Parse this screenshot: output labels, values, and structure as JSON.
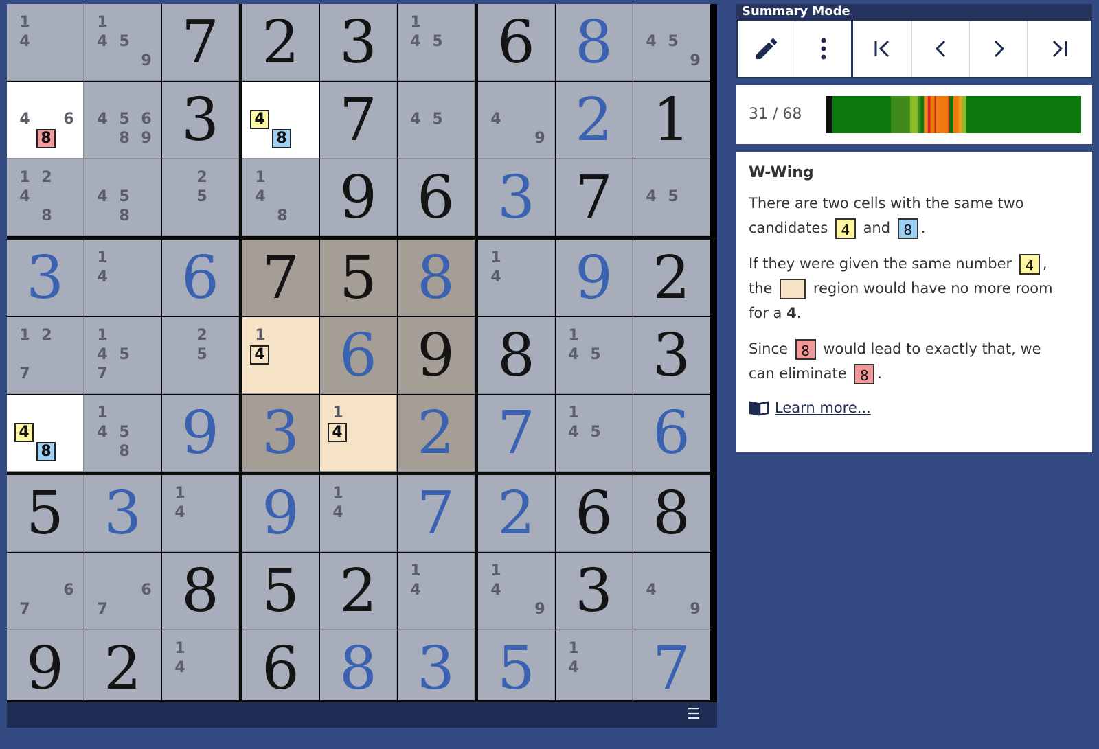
{
  "mode_title": "Summary Mode",
  "toolbar": {
    "buttons": [
      {
        "name": "pencil-button",
        "icon": "pencil-icon"
      },
      {
        "name": "more-options-button",
        "icon": "more-vertical-icon"
      },
      {
        "name": "first-step-button",
        "icon": "skip-first-icon"
      },
      {
        "name": "prev-step-button",
        "icon": "chevron-left-icon"
      },
      {
        "name": "next-step-button",
        "icon": "chevron-right-icon"
      },
      {
        "name": "last-step-button",
        "icon": "skip-last-icon"
      }
    ]
  },
  "progress": {
    "text": "31 / 68",
    "current": 31,
    "total": 68
  },
  "hint": {
    "title": "W-Wing",
    "p1_a": "There are two cells with the same two",
    "p1_b": "candidates",
    "p1_c": "and",
    "p2_a": "If they were given the same number",
    "p2_b": "the",
    "p2_c": "region would have no more room",
    "p2_d": "for a",
    "p2_e": "4",
    "p3_a": "Since",
    "p3_b": "would lead to exactly that, we",
    "p3_c": "can eliminate",
    "chip_4": "4",
    "chip_8": "8",
    "learn_more": "Learn more..."
  },
  "colors": {
    "yellow": "#fff7a1",
    "blue": "#9fd1f4",
    "red": "#f29a9a",
    "peach": "#f6e3c6",
    "given_black": "#141414",
    "given_blue": "#3a62b0"
  },
  "board": {
    "cells": [
      [
        {
          "c": [
            "1",
            "4"
          ]
        },
        {
          "c": [
            "1",
            "4",
            "5",
            "9"
          ]
        },
        {
          "v": "7"
        },
        {
          "v": "2"
        },
        {
          "v": "3"
        },
        {
          "c": [
            "1",
            "4",
            "5"
          ]
        },
        {
          "v": "6"
        },
        {
          "v": "8",
          "b": 1
        },
        {
          "c": [
            "4",
            "5",
            "9"
          ]
        }
      ],
      [
        {
          "c": [
            "4",
            "6"
          ],
          "red": "8",
          "bg": "white"
        },
        {
          "c": [
            "4",
            "5",
            "6",
            "8",
            "9"
          ]
        },
        {
          "v": "3"
        },
        {
          "wing": [
            "4",
            "8"
          ],
          "bg": "white"
        },
        {
          "v": "7"
        },
        {
          "c": [
            "4",
            "5"
          ]
        },
        {
          "c": [
            "4",
            "9"
          ]
        },
        {
          "v": "2",
          "b": 1
        },
        {
          "v": "1"
        }
      ],
      [
        {
          "c": [
            "1",
            "2",
            "4",
            "8"
          ]
        },
        {
          "c": [
            "4",
            "5",
            "8"
          ]
        },
        {
          "c": [
            "2",
            "5"
          ]
        },
        {
          "c": [
            "1",
            "4",
            "8"
          ]
        },
        {
          "v": "9"
        },
        {
          "v": "6"
        },
        {
          "v": "3",
          "b": 1
        },
        {
          "v": "7"
        },
        {
          "c": [
            "4",
            "5"
          ]
        }
      ],
      [
        {
          "v": "3",
          "b": 1
        },
        {
          "c": [
            "1",
            "4"
          ]
        },
        {
          "v": "6",
          "b": 1
        },
        {
          "v": "7",
          "bg": "box"
        },
        {
          "v": "5",
          "bg": "box"
        },
        {
          "v": "8",
          "b": 1,
          "bg": "box"
        },
        {
          "c": [
            "1",
            "4"
          ]
        },
        {
          "v": "9",
          "b": 1
        },
        {
          "v": "2"
        }
      ],
      [
        {
          "c": [
            "1",
            "2",
            "7"
          ]
        },
        {
          "c": [
            "1",
            "4",
            "5",
            "7"
          ]
        },
        {
          "c": [
            "2",
            "5"
          ]
        },
        {
          "peach": [
            "1",
            "4"
          ],
          "bg": "peach"
        },
        {
          "v": "6",
          "b": 1,
          "bg": "box"
        },
        {
          "v": "9",
          "bg": "box"
        },
        {
          "v": "8"
        },
        {
          "c": [
            "1",
            "4",
            "5"
          ]
        },
        {
          "v": "3"
        }
      ],
      [
        {
          "wing": [
            "4",
            "8"
          ],
          "bg": "white"
        },
        {
          "c": [
            "1",
            "4",
            "5",
            "8"
          ]
        },
        {
          "v": "9",
          "b": 1
        },
        {
          "v": "3",
          "b": 1,
          "bg": "box"
        },
        {
          "peach": [
            "1",
            "4"
          ],
          "bg": "peach"
        },
        {
          "v": "2",
          "b": 1,
          "bg": "box"
        },
        {
          "v": "7",
          "b": 1
        },
        {
          "c": [
            "1",
            "4",
            "5"
          ]
        },
        {
          "v": "6",
          "b": 1
        }
      ],
      [
        {
          "v": "5"
        },
        {
          "v": "3",
          "b": 1
        },
        {
          "c": [
            "1",
            "4"
          ]
        },
        {
          "v": "9",
          "b": 1
        },
        {
          "c": [
            "1",
            "4"
          ]
        },
        {
          "v": "7",
          "b": 1
        },
        {
          "v": "2",
          "b": 1
        },
        {
          "v": "6"
        },
        {
          "v": "8"
        }
      ],
      [
        {
          "c": [
            "6",
            "7"
          ]
        },
        {
          "c": [
            "6",
            "7"
          ]
        },
        {
          "v": "8"
        },
        {
          "v": "5"
        },
        {
          "v": "2"
        },
        {
          "c": [
            "1",
            "4"
          ]
        },
        {
          "c": [
            "1",
            "4",
            "9"
          ]
        },
        {
          "v": "3"
        },
        {
          "c": [
            "4",
            "9"
          ]
        }
      ],
      [
        {
          "v": "9"
        },
        {
          "v": "2"
        },
        {
          "c": [
            "1",
            "4"
          ]
        },
        {
          "v": "6"
        },
        {
          "v": "8",
          "b": 1
        },
        {
          "v": "3",
          "b": 1
        },
        {
          "v": "5",
          "b": 1
        },
        {
          "c": [
            "1",
            "4"
          ]
        },
        {
          "v": "7",
          "b": 1
        }
      ]
    ]
  }
}
